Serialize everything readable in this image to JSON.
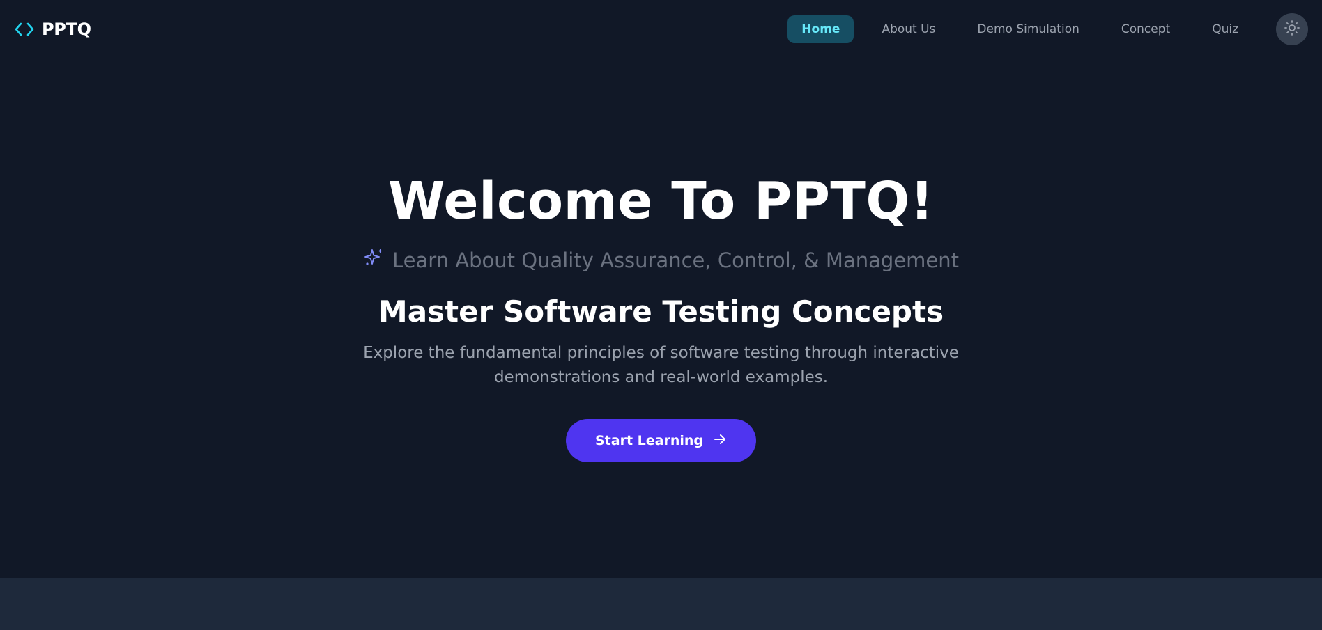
{
  "brand": {
    "name": "PPTQ",
    "icon": "code-brackets-icon",
    "accent": "#22d3ee"
  },
  "nav": {
    "items": [
      {
        "label": "Home",
        "active": true
      },
      {
        "label": "About Us",
        "active": false
      },
      {
        "label": "Demo Simulation",
        "active": false
      },
      {
        "label": "Concept",
        "active": false
      },
      {
        "label": "Quiz",
        "active": false
      }
    ],
    "theme_toggle_icon": "sun-icon"
  },
  "hero": {
    "title": "Welcome To PPTQ!",
    "tagline": "Learn About Quality Assurance, Control, & Management",
    "tagline_icon": "sparkles-icon",
    "subtitle": "Master Software Testing Concepts",
    "description": "Explore the fundamental principles of software testing through interactive demonstrations and real-world examples.",
    "cta_label": "Start Learning",
    "cta_icon": "arrow-right-icon"
  },
  "colors": {
    "background": "#111827",
    "active_nav_bg": "#164e63",
    "active_nav_text": "#67e8f9",
    "cta_bg": "#4f35f0",
    "sparkle": "#818cf8"
  }
}
